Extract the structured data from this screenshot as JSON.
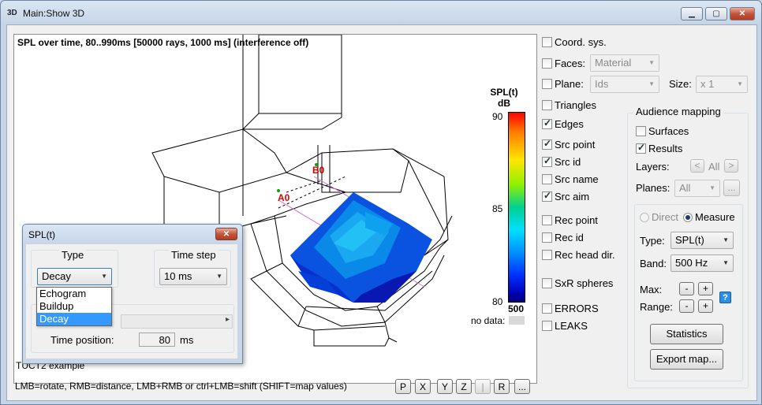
{
  "window": {
    "title": "Main:Show 3D",
    "icon_text": "3D",
    "min_symbol": "▁",
    "max_symbol": "▢",
    "close_symbol": "✕"
  },
  "view": {
    "title": "SPL over time, 80..990ms [50000 rays, 1000 ms] (interference off)",
    "source_labels": [
      "A0",
      "B0"
    ],
    "legend": {
      "title_line1": "SPL(t)",
      "title_line2": "dB",
      "tick_top": "90",
      "tick_mid": "85",
      "tick_bottom": "80",
      "freq": "500",
      "no_data": "no data:"
    },
    "status_left": "TUCT2 example",
    "hint": "LMB=rotate, RMB=distance, LMB+RMB or ctrl+LMB=shift (SHIFT=map values)",
    "buttons": [
      "P",
      "X",
      "Y",
      "Z",
      "|",
      "R",
      "..."
    ]
  },
  "options": {
    "coord_sys": {
      "label": "Coord. sys.",
      "checked": false
    },
    "faces": {
      "label": "Faces:",
      "checked": false,
      "value": "Material"
    },
    "plane": {
      "label": "Plane:",
      "checked": false,
      "value": "Ids",
      "size_label": "Size:",
      "size_value": "x 1"
    },
    "triangles": {
      "label": "Triangles",
      "checked": false
    },
    "edges": {
      "label": "Edges",
      "checked": true
    },
    "src_point": {
      "label": "Src point",
      "checked": true
    },
    "src_id": {
      "label": "Src id",
      "checked": true
    },
    "src_name": {
      "label": "Src name",
      "checked": false
    },
    "src_aim": {
      "label": "Src aim",
      "checked": true
    },
    "rec_point": {
      "label": "Rec point",
      "checked": false
    },
    "rec_id": {
      "label": "Rec id",
      "checked": false
    },
    "rec_head": {
      "label": "Rec head dir.",
      "checked": false
    },
    "sxr": {
      "label": "SxR spheres",
      "checked": false
    },
    "errors": {
      "label": "ERRORS",
      "checked": false
    },
    "leaks": {
      "label": "LEAKS",
      "checked": false
    }
  },
  "audience": {
    "title": "Audience mapping",
    "surfaces": {
      "label": "Surfaces",
      "checked": false
    },
    "results": {
      "label": "Results",
      "checked": true
    },
    "layers_label": "Layers:",
    "layers_prev": "<",
    "layers_value": "All",
    "layers_next": ">",
    "planes_label": "Planes:",
    "planes_value": "All",
    "planes_more": "...",
    "direct_label": "Direct",
    "measure_label": "Measure",
    "type_label": "Type:",
    "type_value": "SPL(t)",
    "band_label": "Band:",
    "band_value": "500 Hz",
    "max_label": "Max:",
    "range_label": "Range:",
    "minus": "-",
    "plus": "+",
    "help": "?",
    "statistics": "Statistics",
    "export": "Export map..."
  },
  "dialog": {
    "title": "SPL(t)",
    "close_symbol": "✕",
    "type_group": "Type",
    "type_value": "Decay",
    "type_options": [
      "Echogram",
      "Buildup",
      "Decay"
    ],
    "type_selected": "Decay",
    "timestep_group": "Time step",
    "timestep_value": "10 ms",
    "time_position_label": "Time position:",
    "time_position_value": "80",
    "time_unit": "ms",
    "slider_arrow": "▸"
  }
}
